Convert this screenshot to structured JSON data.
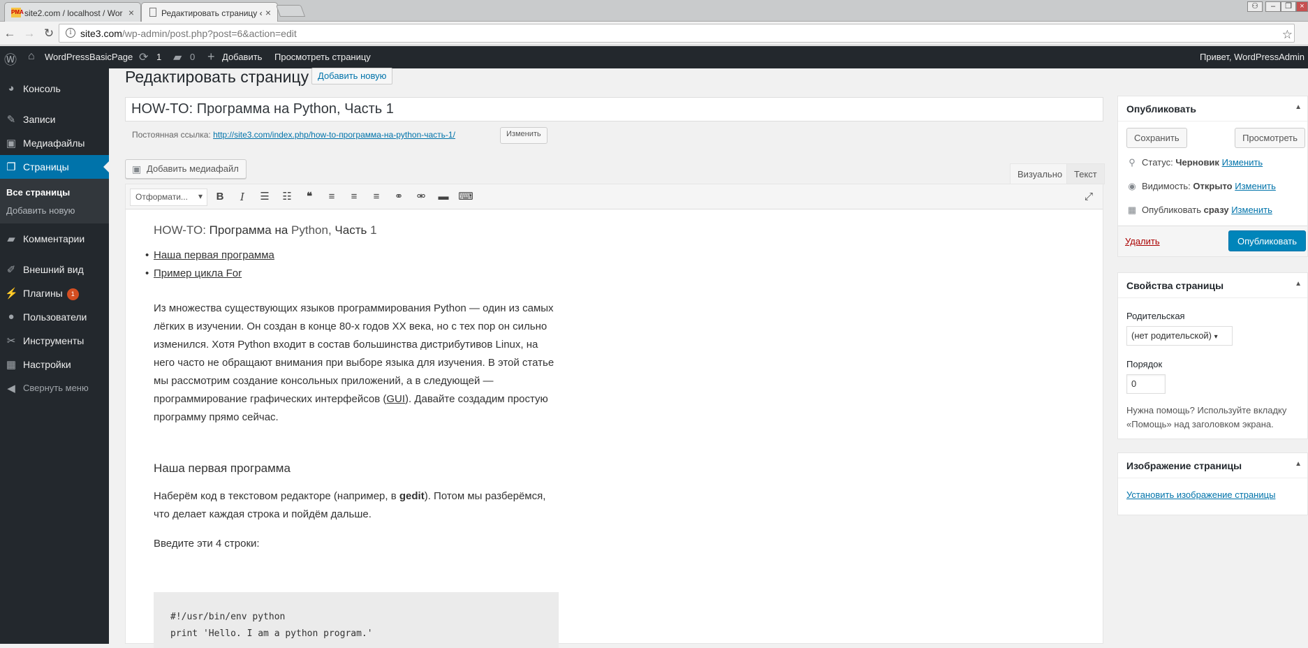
{
  "browser": {
    "tabs": [
      {
        "title": "site2.com / localhost / Wor",
        "favicon": "PMA"
      },
      {
        "title": "Редактировать страницу ‹"
      }
    ],
    "url_host": "site3.com",
    "url_path": "/wp-admin/post.php?post=6&action=edit"
  },
  "adminbar": {
    "site_name": "WordPressBasicPage",
    "updates_count": "1",
    "comments_count": "0",
    "new_label": "Добавить",
    "view_label": "Просмотреть страницу",
    "greeting": "Привет, WordPressAdmin"
  },
  "sidebar": {
    "items": [
      {
        "label": "Консоль",
        "icon": "dashboard-icon"
      },
      {
        "label": "Записи",
        "icon": "pin-icon"
      },
      {
        "label": "Медиафайлы",
        "icon": "media-icon"
      },
      {
        "label": "Страницы",
        "icon": "pages-icon"
      },
      {
        "label": "Комментарии",
        "icon": "comments-icon"
      },
      {
        "label": "Внешний вид",
        "icon": "appearance-icon"
      },
      {
        "label": "Плагины",
        "icon": "plugins-icon"
      },
      {
        "label": "Пользователи",
        "icon": "users-icon"
      },
      {
        "label": "Инструменты",
        "icon": "tools-icon"
      },
      {
        "label": "Настройки",
        "icon": "settings-icon"
      },
      {
        "label": "Свернуть меню",
        "icon": "collapse-icon"
      }
    ],
    "plugins_badge": "1",
    "sub": [
      "Все страницы",
      "Добавить новую"
    ]
  },
  "main": {
    "heading": "Редактировать страницу",
    "add_new": "Добавить новую",
    "title_value": "HOW-TO: Программа на Python, Часть 1",
    "permalink_label": "Постоянная ссылка:",
    "permalink_url": "http://site3.com/index.php/how-to-программа-на-python-часть-1/",
    "permalink_edit": "Изменить",
    "add_media": "Добавить медиафайл",
    "tab_visual": "Визуально",
    "tab_text": "Текст",
    "format_select": "Отформати..."
  },
  "content": {
    "title_a": "HOW-TO: ",
    "title_b": "Программа на",
    "title_c": " Python, ",
    "title_d": "Часть",
    "title_e": " 1",
    "toc": [
      "Наша первая программа",
      "Пример цикла For"
    ],
    "intro_a": "Из множества существующих языков программирования Python — один из самых лёгких в изучении. Он создан в конце 80-х годов XX века, но с тех пор он сильно изменился. Хотя Python входит в состав большинства дистрибутивов Linux, на него часто не обращают внимания при выборе языка для изучения. В этой статье мы рассмотрим создание консольных приложений, а в следующей — программирование графических интерфейсов (",
    "intro_gui": "GUI",
    "intro_b": "). Давайте создадим простую программу прямо сейчас.",
    "h2": "Наша первая программа",
    "p2_a": "Наберём код в текстовом редакторе (например, в ",
    "p2_bold": "gedit",
    "p2_b": "). Потом мы разберёмся, что делает каждая строка и пойдём дальше.",
    "p3": "Введите эти 4 строки:",
    "code": [
      "#!/usr/bin/env python",
      "print 'Hello. I am a python program.'"
    ]
  },
  "publish": {
    "title": "Опубликовать",
    "save": "Сохранить",
    "preview": "Просмотреть",
    "status_label": "Статус:",
    "status_value": "Черновик",
    "visibility_label": "Видимость:",
    "visibility_value": "Открыто",
    "publish_label": "Опубликовать",
    "publish_value": "сразу",
    "edit": "Изменить",
    "delete": "Удалить",
    "publish_btn": "Опубликовать"
  },
  "page_attrs": {
    "title": "Свойства страницы",
    "parent_label": "Родительская",
    "parent_value": "(нет родительской)",
    "order_label": "Порядок",
    "order_value": "0",
    "help": "Нужна помощь? Используйте вкладку «Помощь» над заголовком экрана."
  },
  "featured": {
    "title": "Изображение страницы",
    "set_link": "Установить изображение страницы"
  },
  "colors": {
    "admin_dark": "#23282d",
    "accent": "#0073aa",
    "primary_btn": "#0085ba",
    "badge": "#d54e21",
    "delete": "#a00"
  }
}
